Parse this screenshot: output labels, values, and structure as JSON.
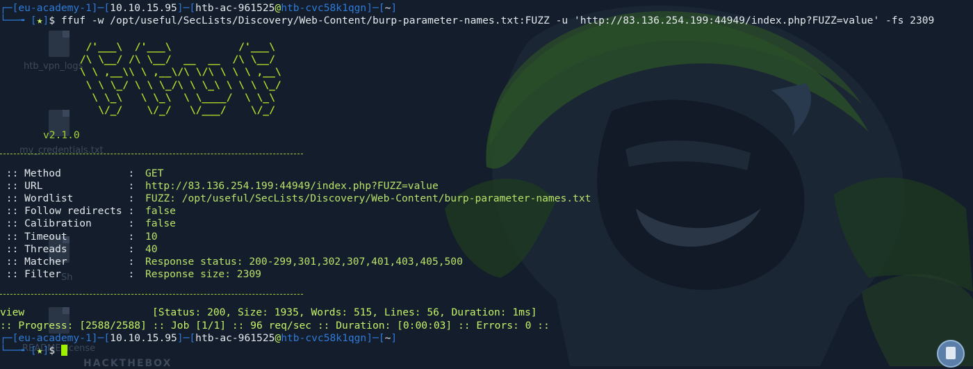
{
  "prompt_top": {
    "region": "eu-academy-1",
    "ip": "10.10.15.95",
    "user": "htb-ac-961525",
    "host": "htb-cvc58k1qgn",
    "cwd": "~",
    "star": "★",
    "command": "ffuf -w /opt/useful/SecLists/Discovery/Web-Content/burp-parameter-names.txt:FUZZ -u 'http://83.136.254.199:44949/index.php?FUZZ=value' -fs 2309"
  },
  "banner": {
    "art": "       /'___\\  /'___\\           /'___\\\n      /\\ \\__/ /\\ \\__/  __  __  /\\ \\__/\n      \\ \\ ,__\\\\ \\ ,__\\/\\ \\/\\ \\ \\ \\ ,__\\\n       \\ \\ \\_/ \\ \\ \\_/\\ \\ \\_\\ \\ \\ \\ \\_/\n        \\ \\_\\   \\ \\_\\  \\ \\____/  \\ \\_\\\n         \\/_/    \\/_/   \\/___/    \\/_/",
    "version": "v2.1.0"
  },
  "config": [
    {
      "key": " :: Method           :",
      "value": "GET"
    },
    {
      "key": " :: URL              :",
      "value": "http://83.136.254.199:44949/index.php?FUZZ=value"
    },
    {
      "key": " :: Wordlist         :",
      "value": "FUZZ: /opt/useful/SecLists/Discovery/Web-Content/burp-parameter-names.txt"
    },
    {
      "key": " :: Follow redirects :",
      "value": "false"
    },
    {
      "key": " :: Calibration      :",
      "value": "false"
    },
    {
      "key": " :: Timeout          :",
      "value": "10"
    },
    {
      "key": " :: Threads          :",
      "value": "40"
    },
    {
      "key": " :: Matcher          :",
      "value": "Response status: 200-299,301,302,307,401,403,405,500"
    },
    {
      "key": " :: Filter           :",
      "value": "Response size: 2309"
    }
  ],
  "result": {
    "word": "view",
    "details": "[Status: 200, Size: 1935, Words: 515, Lines: 56, Duration: 1ms]"
  },
  "progress": ":: Progress: [2588/2588] :: Job [1/1] :: 96 req/sec :: Duration: [0:00:03] :: Errors: 0 ::",
  "prompt_bottom": {
    "region": "eu-academy-1",
    "ip": "10.10.15.95",
    "user": "htb-ac-961525",
    "host": "htb-cvc58k1qgn",
    "cwd": "~",
    "star": "★"
  },
  "desktop_items": [
    {
      "label": "htb_vpn_logs"
    },
    {
      "label": "my_credentials.txt"
    },
    {
      "label": "Sh"
    },
    {
      "label": "README.license"
    },
    {
      "label": "HACKTHEBOX"
    }
  ],
  "colors": {
    "background": "#141d2b",
    "accent_green": "#9fef00",
    "prompt_blue": "#2f7bd8"
  }
}
